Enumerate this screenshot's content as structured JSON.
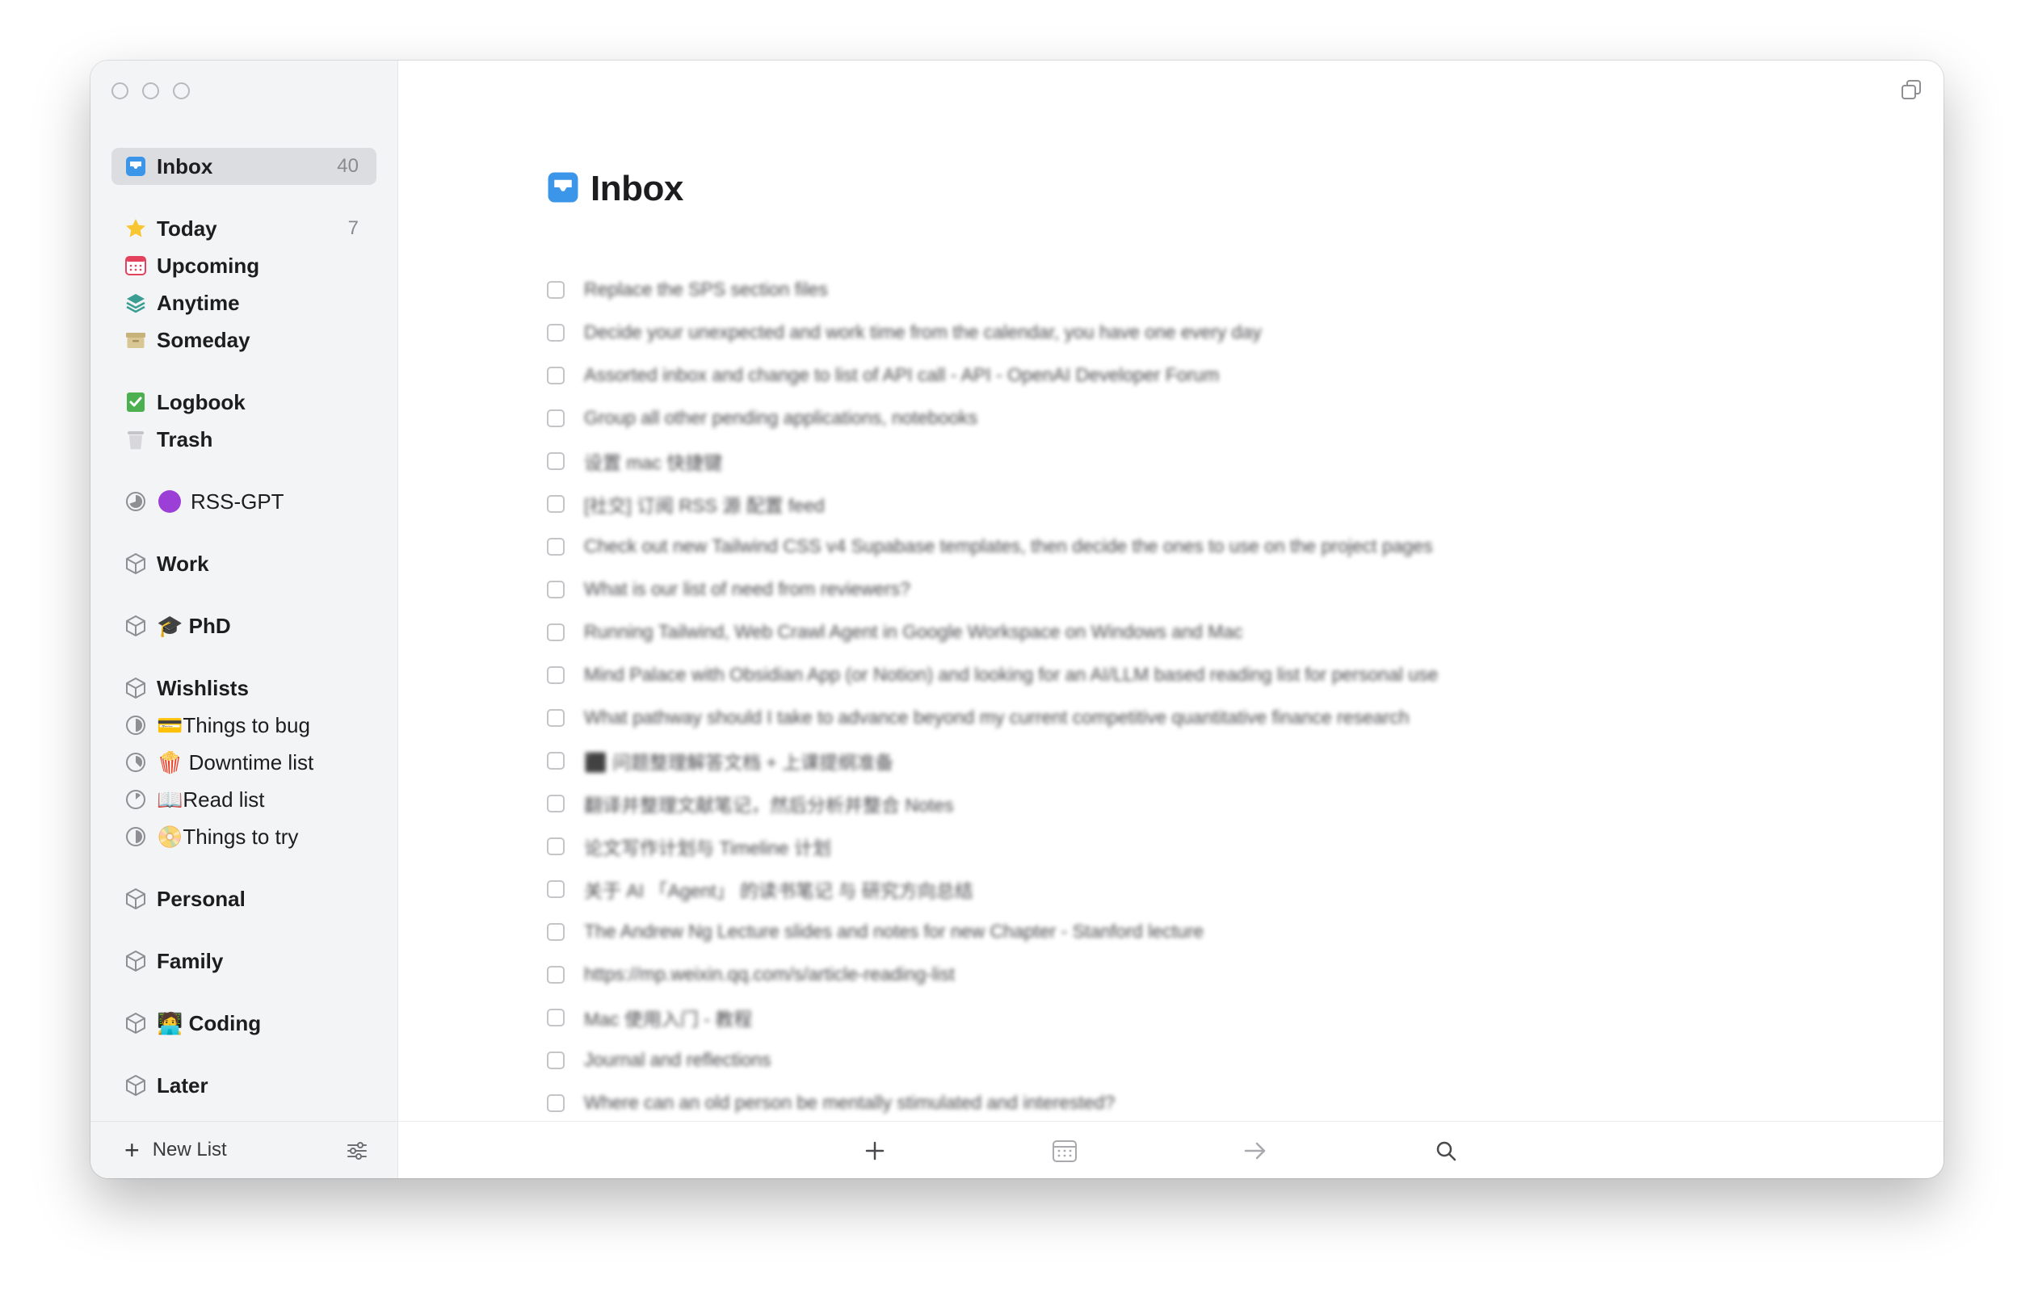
{
  "sidebar": {
    "inbox": {
      "label": "Inbox",
      "count": "40"
    },
    "today": {
      "label": "Today",
      "count": "7"
    },
    "upcoming": {
      "label": "Upcoming"
    },
    "anytime": {
      "label": "Anytime"
    },
    "someday": {
      "label": "Someday"
    },
    "logbook": {
      "label": "Logbook"
    },
    "trash": {
      "label": "Trash"
    },
    "rss": {
      "label": "RSS-GPT"
    },
    "work": {
      "label": "Work"
    },
    "phd": {
      "label": "🎓 PhD"
    },
    "wishlists": {
      "label": "Wishlists"
    },
    "things_to_bug": {
      "label": "💳Things to bug"
    },
    "downtime": {
      "label": "🍿 Downtime list"
    },
    "read_list": {
      "label": "📖Read list"
    },
    "things_to_try": {
      "label": "📀Things to try"
    },
    "personal": {
      "label": "Personal"
    },
    "family": {
      "label": "Family"
    },
    "coding": {
      "label": "🧑‍💻 Coding"
    },
    "later": {
      "label": "Later"
    },
    "new_list": {
      "label": "New List"
    }
  },
  "main": {
    "title": "Inbox",
    "tasks": [
      "Replace the SPS section files",
      "Decide your unexpected and work time from the calendar, you have one every day",
      "Assorted inbox and change to list of API call - API - OpenAI Developer Forum",
      "Group all other pending applications, notebooks",
      "设置 mac 快捷键",
      "[社交] 订阅 RSS 源 配置 feed",
      "Check out new Tailwind CSS v4 Supabase templates, then decide the ones to use on the project pages",
      "What is our list of need from reviewers?",
      "Running Tailwind, Web Crawl Agent in Google Workspace on Windows and Mac",
      "Mind Palace with Obsidian App (or Notion) and looking for an AI/LLM based reading list for personal use",
      "What pathway should I take to advance beyond my current competitive quantitative finance research",
      "⬛ 问题整理解答文档 + 上课提纲准备",
      "翻译并整理文献笔记，然后分析并整合 Notes",
      "论文写作计划与 Timeline 计划",
      "关于 AI 「Agent」 的读书笔记 与 研究方向总结",
      "The Andrew Ng Lecture slides and notes for new Chapter - Stanford lecture",
      "https://mp.weixin.qq.com/s/article-reading-list",
      "Mac 使用入门 - 教程",
      "Journal and reflections",
      "Where can an old person be mentally stimulated and interested?"
    ]
  },
  "colors": {
    "accent": "#2f8ff0",
    "sidebar_bg": "#f3f4f6",
    "selected_bg": "#dcdde1"
  }
}
